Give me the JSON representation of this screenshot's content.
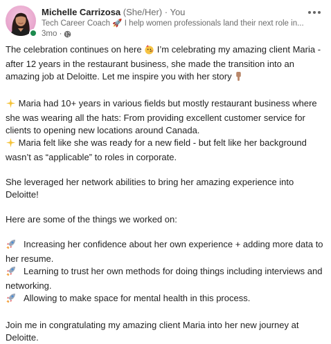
{
  "author": {
    "name": "Michelle Carrizosa",
    "pronouns": "(She/Her)",
    "connection": "· You",
    "headline": "Tech Career Coach 🚀 I help women professionals land their next role in...",
    "time": "3mo ·"
  },
  "icons": {
    "avatar": "profile-photo",
    "status": "online-status-dot",
    "visibility": "globe-icon",
    "menu": "more-options-icon",
    "party": "partying-face-emoji",
    "point": "pointing-down-emoji",
    "sparkles": "sparkles-emoji",
    "rocket": "rocket-emoji"
  },
  "colors": {
    "status_green": "#1d8a4e",
    "meta_gray": "#6b6b6b",
    "text": "#1f1f1f"
  },
  "post": {
    "p1": {
      "a": "The celebration continues on here ",
      "b": " I’m celebrating my amazing client Maria - after 12 years in the restaurant business, she made the transition into an amazing job at Deloitte. Let me inspire you with her story "
    },
    "p2": {
      "a": " Maria had 10+ years in various fields but mostly restaurant business where she was wearing all the hats: From providing excellent customer service for clients to opening new locations around Canada.",
      "b": "  Maria felt like she was ready for a new field - but felt like her background wasn’t as “applicable” to roles in corporate."
    },
    "p3": "She leveraged her network abilities to bring her amazing experience into Deloitte!",
    "p4": "Here are some of the things we worked on:",
    "bullets": [
      "Increasing her confidence about her own experience + adding more data to her resume.",
      "Learning to trust her own methods for doing things including interviews and networking.",
      "Allowing to make space for mental health in this process."
    ],
    "p5": "Join me in congratulating my amazing client Maria into her new journey at Deloitte."
  }
}
